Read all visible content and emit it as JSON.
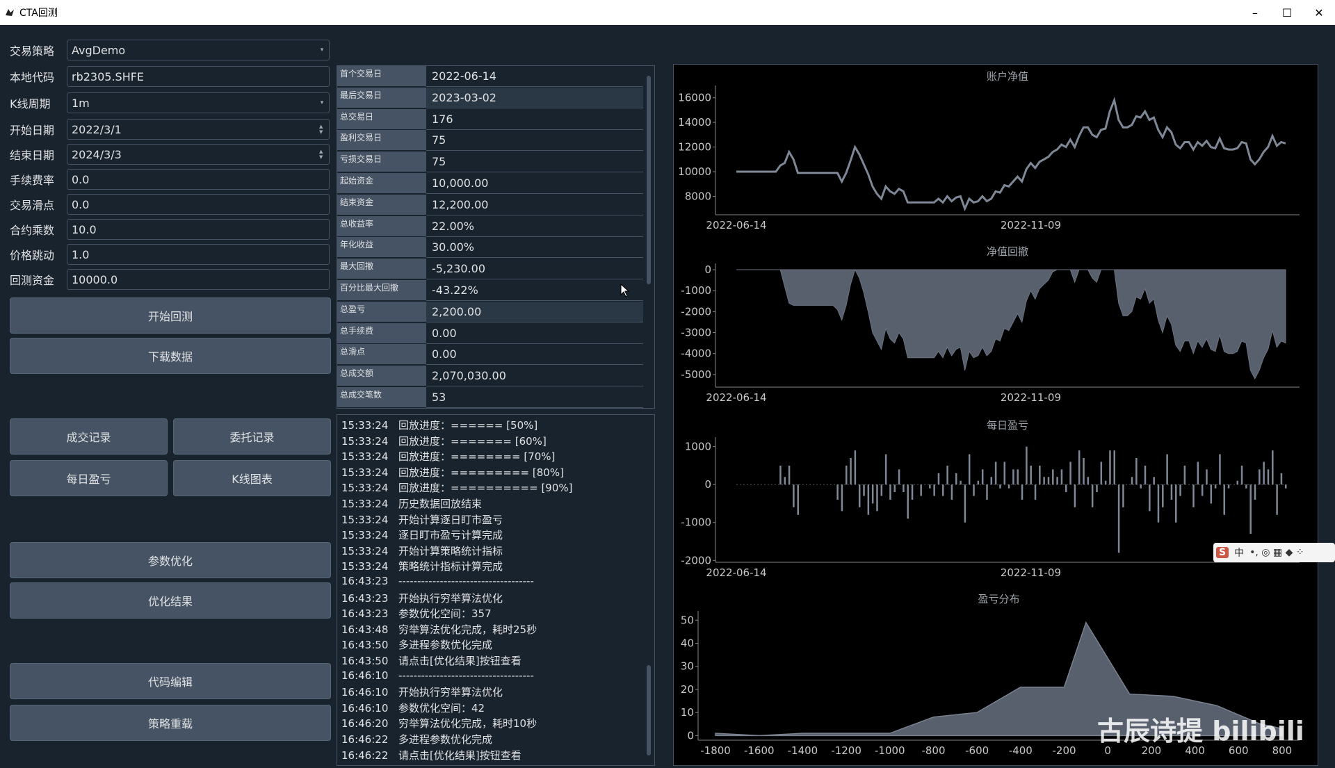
{
  "window": {
    "title": "CTA回测",
    "minimize": "–",
    "maximize": "☐",
    "close": "✕"
  },
  "form": {
    "strategy": {
      "label": "交易策略",
      "value": "AvgDemo"
    },
    "symbol": {
      "label": "本地代码",
      "value": "rb2305.SHFE"
    },
    "interval": {
      "label": "K线周期",
      "value": "1m"
    },
    "start": {
      "label": "开始日期",
      "value": "2022/3/1"
    },
    "end": {
      "label": "结束日期",
      "value": "2024/3/3"
    },
    "rate": {
      "label": "手续费率",
      "value": "0.0"
    },
    "slippage": {
      "label": "交易滑点",
      "value": "0.0"
    },
    "size": {
      "label": "合约乘数",
      "value": "10.0"
    },
    "pricetick": {
      "label": "价格跳动",
      "value": "1.0"
    },
    "capital": {
      "label": "回测资金",
      "value": "10000.0"
    }
  },
  "buttons": {
    "start_backtest": "开始回测",
    "download": "下载数据",
    "trades": "成交记录",
    "orders": "委托记录",
    "daily": "每日盈亏",
    "kline": "K线图表",
    "optimize": "参数优化",
    "opt_result": "优化结果",
    "edit_code": "代码编辑",
    "reload": "策略重载"
  },
  "results": [
    {
      "key": "首个交易日",
      "value": "2022-06-14"
    },
    {
      "key": "最后交易日",
      "value": "2023-03-02"
    },
    {
      "key": "总交易日",
      "value": "176"
    },
    {
      "key": "盈利交易日",
      "value": "75"
    },
    {
      "key": "亏损交易日",
      "value": "75"
    },
    {
      "key": "起始资金",
      "value": "10,000.00"
    },
    {
      "key": "结束资金",
      "value": "12,200.00"
    },
    {
      "key": "总收益率",
      "value": "22.00%"
    },
    {
      "key": "年化收益",
      "value": "30.00%"
    },
    {
      "key": "最大回撤",
      "value": "-5,230.00"
    },
    {
      "key": "百分比最大回撤",
      "value": "-43.22%"
    },
    {
      "key": "总盈亏",
      "value": "2,200.00"
    },
    {
      "key": "总手续费",
      "value": "0.00"
    },
    {
      "key": "总滑点",
      "value": "0.00"
    },
    {
      "key": "总成交额",
      "value": "2,070,030.00"
    },
    {
      "key": "总成交笔数",
      "value": "53"
    }
  ],
  "log": [
    {
      "time": "15:33:24",
      "msg": "回放进度：====== [50%]"
    },
    {
      "time": "15:33:24",
      "msg": "回放进度：======= [60%]"
    },
    {
      "time": "15:33:24",
      "msg": "回放进度：======== [70%]"
    },
    {
      "time": "15:33:24",
      "msg": "回放进度：========= [80%]"
    },
    {
      "time": "15:33:24",
      "msg": "回放进度：========== [90%]"
    },
    {
      "time": "15:33:24",
      "msg": "历史数据回放结束"
    },
    {
      "time": "15:33:24",
      "msg": "开始计算逐日盯市盈亏"
    },
    {
      "time": "15:33:24",
      "msg": "逐日盯市盈亏计算完成"
    },
    {
      "time": "15:33:24",
      "msg": "开始计算策略统计指标"
    },
    {
      "time": "15:33:24",
      "msg": "策略统计指标计算完成"
    },
    {
      "time": "16:43:23",
      "msg": "------------------------------------"
    },
    {
      "time": "16:43:23",
      "msg": "开始执行穷举算法优化"
    },
    {
      "time": "16:43:23",
      "msg": "参数优化空间：357"
    },
    {
      "time": "16:43:48",
      "msg": "穷举算法优化完成，耗时25秒"
    },
    {
      "time": "16:43:50",
      "msg": "多进程参数优化完成"
    },
    {
      "time": "16:43:50",
      "msg": "请点击[优化结果]按钮查看"
    },
    {
      "time": "16:46:10",
      "msg": "------------------------------------"
    },
    {
      "time": "16:46:10",
      "msg": "开始执行穷举算法优化"
    },
    {
      "time": "16:46:10",
      "msg": "参数优化空间：42"
    },
    {
      "time": "16:46:20",
      "msg": "穷举算法优化完成，耗时10秒"
    },
    {
      "time": "16:46:22",
      "msg": "多进程参数优化完成"
    },
    {
      "time": "16:46:22",
      "msg": "请点击[优化结果]按钮查看"
    }
  ],
  "chart_data": [
    {
      "type": "line",
      "title": "账户净值",
      "x_ticks": [
        "2022-06-14",
        "2022-11-09"
      ],
      "y_ticks": [
        16000,
        14000,
        12000,
        10000,
        8000
      ],
      "ylim": [
        6500,
        17000
      ],
      "series": [
        {
          "values": [
            10000,
            10000,
            10000,
            10000,
            10000,
            10000,
            10000,
            10000,
            10000,
            10000,
            10500,
            10700,
            11600,
            11000,
            9900,
            9900,
            9900,
            9900,
            9900,
            9900,
            9900,
            9900,
            9900,
            9900,
            9200,
            9900,
            10900,
            12000,
            11400,
            10600,
            9800,
            8800,
            8200,
            7800,
            8800,
            8400,
            8200,
            8600,
            8400,
            7500,
            7500,
            7500,
            7500,
            7500,
            7500,
            7500,
            7800,
            7500,
            8000,
            7600,
            7900,
            8000,
            7000,
            7800,
            7500,
            7600,
            8000,
            7600,
            7800,
            8400,
            8300,
            8900,
            8800,
            9200,
            9600,
            9200,
            10200,
            10700,
            10300,
            10800,
            11000,
            11200,
            11600,
            11800,
            12200,
            12000,
            12600,
            12000,
            12900,
            13600,
            13600,
            13000,
            12800,
            13400,
            13500,
            14900,
            15800,
            14200,
            13600,
            13600,
            13800,
            14500,
            14400,
            14900,
            14200,
            14400,
            13400,
            12800,
            13600,
            13200,
            12200,
            11900,
            12400,
            12400,
            11800,
            12400,
            12100,
            12500,
            12000,
            11900,
            12700,
            11900,
            11800,
            11800,
            11900,
            12400,
            12300,
            11000,
            10600,
            11000,
            11600,
            12000,
            12900,
            12100,
            12400,
            12300
          ]
        }
      ]
    },
    {
      "type": "area",
      "title": "净值回撤",
      "x_ticks": [
        "2022-06-14",
        "2022-11-09"
      ],
      "y_ticks": [
        0,
        -1000,
        -2000,
        -3000,
        -4000,
        -5000
      ],
      "ylim": [
        -5600,
        300
      ],
      "series": [
        {
          "values": [
            0,
            0,
            0,
            0,
            0,
            0,
            0,
            0,
            0,
            0,
            0,
            -800,
            -1600,
            -1700,
            -1700,
            -1700,
            -1700,
            -1700,
            -1700,
            -1700,
            -1700,
            -1700,
            -1700,
            -1900,
            -2400,
            -1700,
            -700,
            0,
            -400,
            -1100,
            -2000,
            -3000,
            -3400,
            -3800,
            -2800,
            -3300,
            -3500,
            -3000,
            -3300,
            -4200,
            -4200,
            -4200,
            -4200,
            -4200,
            -4200,
            -4200,
            -3900,
            -4200,
            -3700,
            -4100,
            -3800,
            -3700,
            -4800,
            -3900,
            -4200,
            -4100,
            -3700,
            -4100,
            -3900,
            -3300,
            -3400,
            -2800,
            -2900,
            -2500,
            -2100,
            -2500,
            -1500,
            -1000,
            -1400,
            -900,
            -700,
            -500,
            -100,
            0,
            0,
            0,
            0,
            -600,
            0,
            0,
            0,
            -400,
            -600,
            0,
            0,
            0,
            0,
            -1600,
            -2200,
            -2200,
            -2000,
            -1300,
            -1400,
            -900,
            -1600,
            -1400,
            -2400,
            -3000,
            -2200,
            -2600,
            -3600,
            -3900,
            -3400,
            -3400,
            -4000,
            -3400,
            -3700,
            -3300,
            -3800,
            -3900,
            -3100,
            -3900,
            -4000,
            -4000,
            -3900,
            -3400,
            -3500,
            -4800,
            -5200,
            -4800,
            -4200,
            -3800,
            -2900,
            -3700,
            -3400,
            -3500
          ]
        }
      ]
    },
    {
      "type": "bar",
      "title": "每日盈亏",
      "x_ticks": [
        "2022-06-14",
        "2022-11-09"
      ],
      "y_ticks": [
        1000,
        0,
        -1000,
        -2000
      ],
      "ylim": [
        -2050,
        1250
      ],
      "values": [
        0,
        0,
        0,
        0,
        0,
        0,
        0,
        0,
        0,
        0,
        500,
        200,
        500,
        -600,
        -800,
        0,
        0,
        0,
        0,
        0,
        0,
        0,
        0,
        -400,
        -700,
        500,
        700,
        900,
        -600,
        -300,
        -800,
        -500,
        -700,
        -300,
        800,
        -400,
        -200,
        400,
        -200,
        -900,
        -400,
        0,
        -300,
        0,
        -100,
        -300,
        300,
        -300,
        500,
        -400,
        300,
        100,
        -1000,
        800,
        -300,
        100,
        400,
        -400,
        200,
        600,
        -100,
        600,
        -100,
        400,
        400,
        -400,
        1000,
        500,
        -400,
        500,
        200,
        200,
        400,
        200,
        400,
        -200,
        600,
        -600,
        900,
        700,
        200,
        -600,
        -200,
        600,
        100,
        900,
        900,
        -1800,
        -600,
        0,
        200,
        700,
        -100,
        500,
        -700,
        200,
        -1000,
        -600,
        800,
        -400,
        -1000,
        -300,
        500,
        0,
        -600,
        600,
        -300,
        400,
        -500,
        -100,
        800,
        -800,
        -100,
        0,
        100,
        500,
        -100,
        -1300,
        -400,
        400,
        600,
        400,
        900,
        -800,
        300,
        -100
      ]
    },
    {
      "type": "area",
      "title": "盈亏分布",
      "x_ticks": [
        -1800,
        -1600,
        -1400,
        -1200,
        -1000,
        -800,
        -600,
        -400,
        -200,
        0,
        200,
        400,
        600,
        800
      ],
      "y_ticks": [
        50,
        40,
        30,
        20,
        10,
        0
      ],
      "xlim": [
        -1880,
        880
      ],
      "ylim": [
        -2,
        54
      ],
      "x": [
        -1800,
        -1600,
        -1400,
        -1200,
        -1000,
        -800,
        -600,
        -400,
        -200,
        -100,
        100,
        300,
        500,
        700,
        800
      ],
      "values": [
        1,
        0,
        1,
        1,
        1,
        8,
        10,
        21,
        21,
        49,
        18,
        17,
        13,
        5,
        3
      ]
    }
  ],
  "ime": {
    "logo": "S",
    "lang": "中",
    "items": "•, ◎ ▦ ◆ ⁘"
  },
  "watermark": "古辰诗提 bilibili"
}
